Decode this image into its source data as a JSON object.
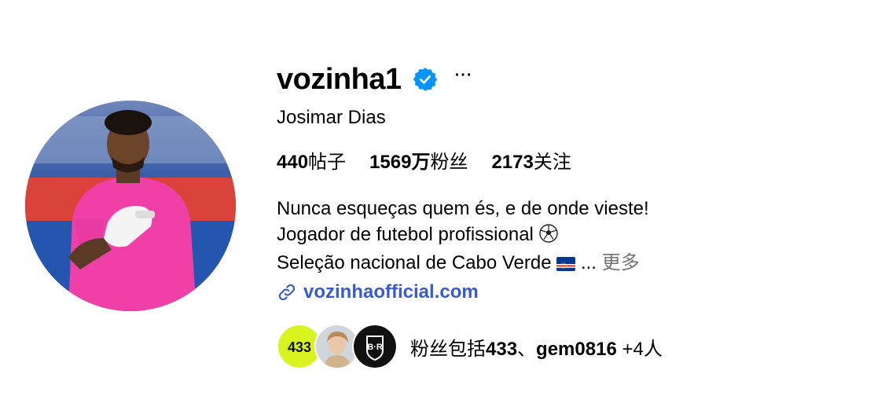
{
  "profile": {
    "username": "vozinha1",
    "more_label": "···",
    "full_name": "Josimar Dias",
    "posts_count": "440",
    "posts_label": "帖子",
    "followers_count": "1569万",
    "followers_label": "粉丝",
    "following_count": "2173",
    "following_label": "关注"
  },
  "bio": {
    "line1": "Nunca esqueças quem és, e de onde vieste!",
    "line2": "Jogador de futebol profissional",
    "line3": "Seleção nacional de Cabo Verde",
    "ellipsis": "...",
    "more_label": "更多"
  },
  "website": {
    "label": "vozinhaofficial.com"
  },
  "followed_by": {
    "prefix": "粉丝包括",
    "name1": "433",
    "separator": "、",
    "name2": "gem0816",
    "suffix": " +4人",
    "avatar1_text": "433",
    "avatar3_text": "B·R"
  },
  "colors": {
    "verified_blue": "#0095f6",
    "link_blue": "#385bcf",
    "muted_gray": "#737373"
  },
  "icons": {
    "verified": "verified-badge-icon",
    "link": "link-icon",
    "soccer": "soccer-ball-icon",
    "flag": "cape-verde-flag-icon"
  }
}
